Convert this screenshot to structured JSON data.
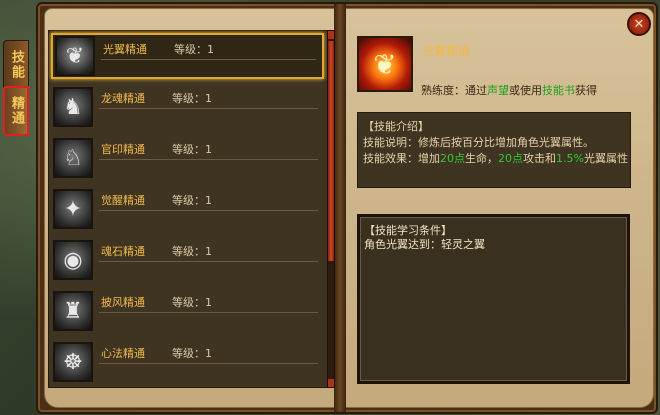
{
  "tabs": [
    {
      "label": "技能"
    },
    {
      "label": "精通"
    }
  ],
  "skill_list": [
    {
      "name": "光翼精通",
      "level_label": "等级：1",
      "icon": "wings-icon"
    },
    {
      "name": "龙魂精通",
      "level_label": "等级：1",
      "icon": "dragon-icon"
    },
    {
      "name": "官印精通",
      "level_label": "等级：1",
      "icon": "seal-icon"
    },
    {
      "name": "觉醒精通",
      "level_label": "等级：1",
      "icon": "awakening-icon"
    },
    {
      "name": "魂石精通",
      "level_label": "等级：1",
      "icon": "soulstone-icon"
    },
    {
      "name": "披风精通",
      "level_label": "等级：1",
      "icon": "cape-icon"
    },
    {
      "name": "心法精通",
      "level_label": "等级：1",
      "icon": "meditation-icon"
    }
  ],
  "detail": {
    "name": "光翼精通",
    "proficiency_prefix": "熟练度：通过",
    "proficiency_link1": "声望",
    "proficiency_mid": "或使用",
    "proficiency_link2": "技能书",
    "proficiency_suffix": "获得",
    "intro_title": "【技能介绍】",
    "desc_line1": "技能说明：修炼后按百分比增加角色光翼属性。",
    "effect_prefix": "技能效果：增加",
    "effect_v1": "20点",
    "effect_t1": "生命，",
    "effect_v2": "20点",
    "effect_t2": "攻击和",
    "effect_v3": "1.5%",
    "effect_t3": "光翼属性",
    "cond_title": "【技能学习条件】",
    "cond_line": "角色光翼达到：轻灵之翼"
  },
  "close_label": "✕",
  "colors": {
    "accent": "#f2b94a",
    "green": "#32c832",
    "selected_border": "#e0a82a"
  }
}
